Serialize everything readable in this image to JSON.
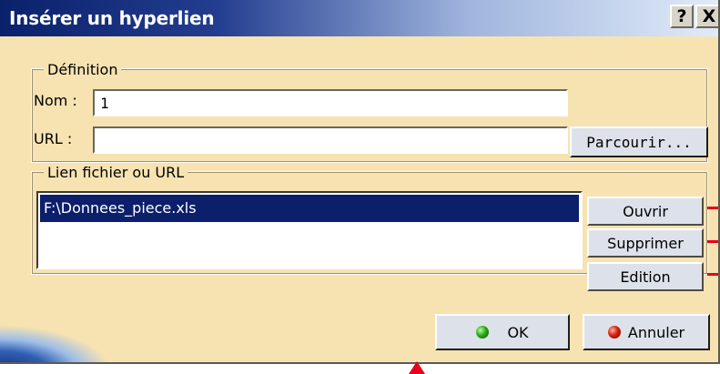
{
  "dialog": {
    "title": "Insérer un hyperlien",
    "help_label": "?",
    "close_label": "X"
  },
  "definition": {
    "group_label": "Définition",
    "name_label": "Nom :",
    "name_value": "1",
    "url_label": "URL :",
    "url_value": "",
    "browse_label": "Parcourir..."
  },
  "links": {
    "group_label": "Lien fichier ou URL",
    "items": [
      "F:\\Donnees_piece.xls"
    ],
    "open_label": "Ouvrir",
    "delete_label": "Supprimer",
    "edit_label": "Edition"
  },
  "footer": {
    "ok_label": "OK",
    "cancel_label": "Annuler"
  },
  "colors": {
    "dialog_background": "#f7e3b2",
    "title_bar": "#0a216b",
    "selection": "#0b1f6a",
    "annotation_red": "#e8001c"
  },
  "icons": {
    "ok": "green-led-icon",
    "cancel": "red-led-icon"
  }
}
